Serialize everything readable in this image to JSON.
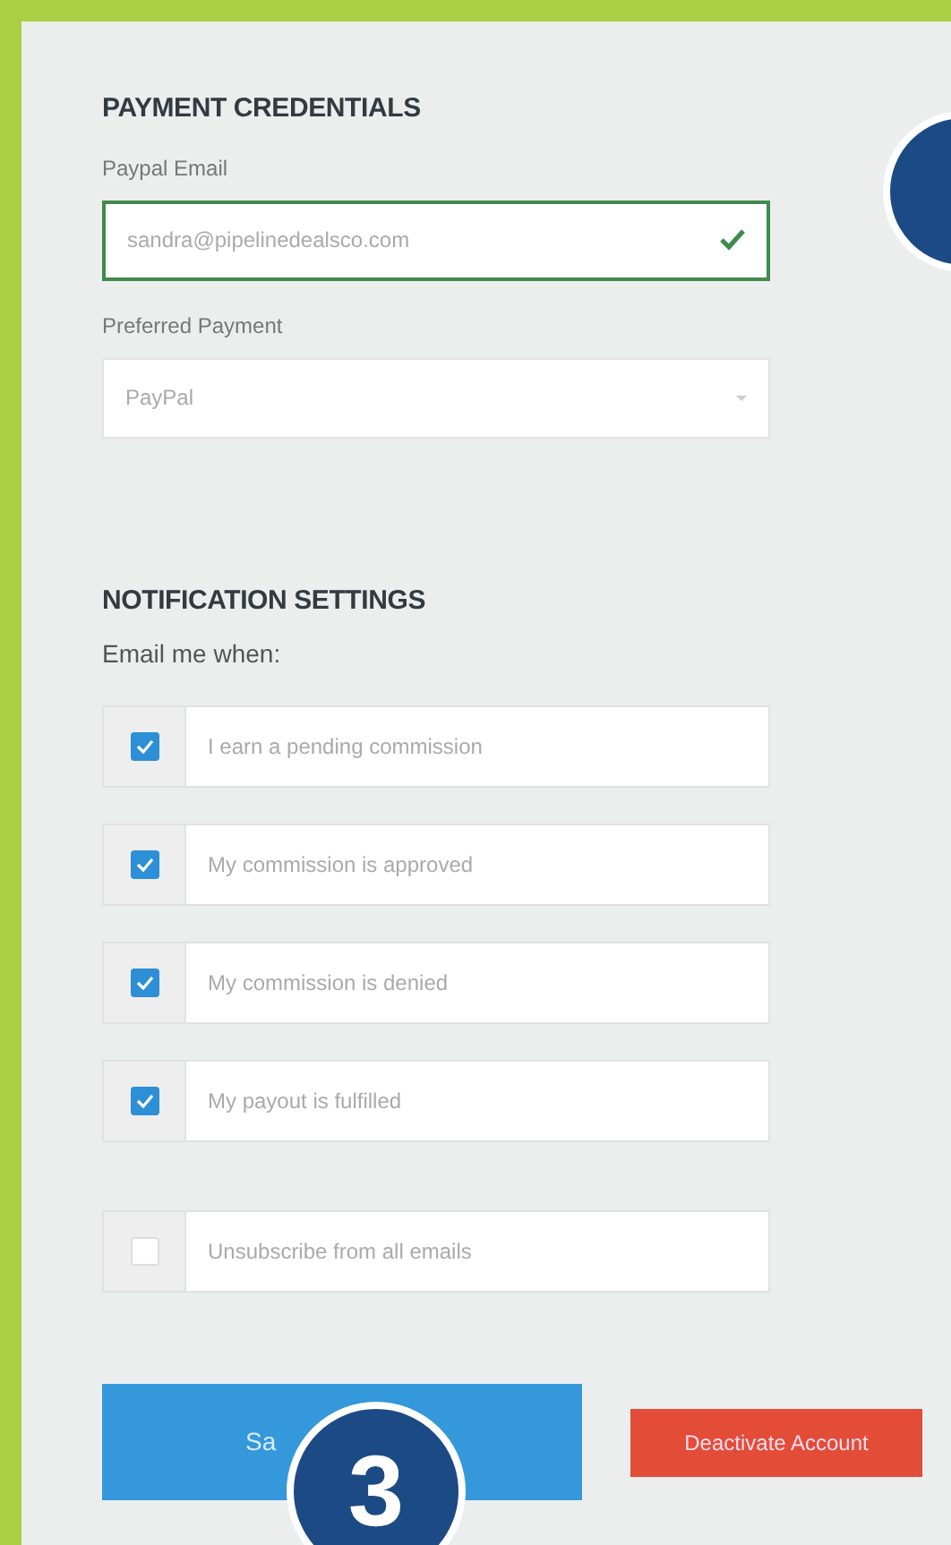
{
  "payment": {
    "title": "PAYMENT CREDENTIALS",
    "email": {
      "label": "Paypal Email",
      "value": "sandra@pipelinedealsco.com",
      "valid": true
    },
    "preferred": {
      "label": "Preferred Payment",
      "value": "PayPal"
    }
  },
  "notifications": {
    "title": "NOTIFICATION SETTINGS",
    "subtitle": "Email me when:",
    "options": [
      {
        "label": "I earn a pending commission",
        "checked": true
      },
      {
        "label": "My commission is approved",
        "checked": true
      },
      {
        "label": "My commission is denied",
        "checked": true
      },
      {
        "label": "My payout is fulfilled",
        "checked": true
      }
    ],
    "unsubscribe": {
      "label": "Unsubscribe from all emails",
      "checked": false
    }
  },
  "buttons": [
    {
      "kind": "primary",
      "label": "Sa"
    },
    {
      "kind": "danger",
      "label": "Deactivate Account"
    }
  ],
  "callouts": [
    {
      "kind": "corner"
    },
    {
      "kind": "step",
      "label": "3"
    }
  ]
}
